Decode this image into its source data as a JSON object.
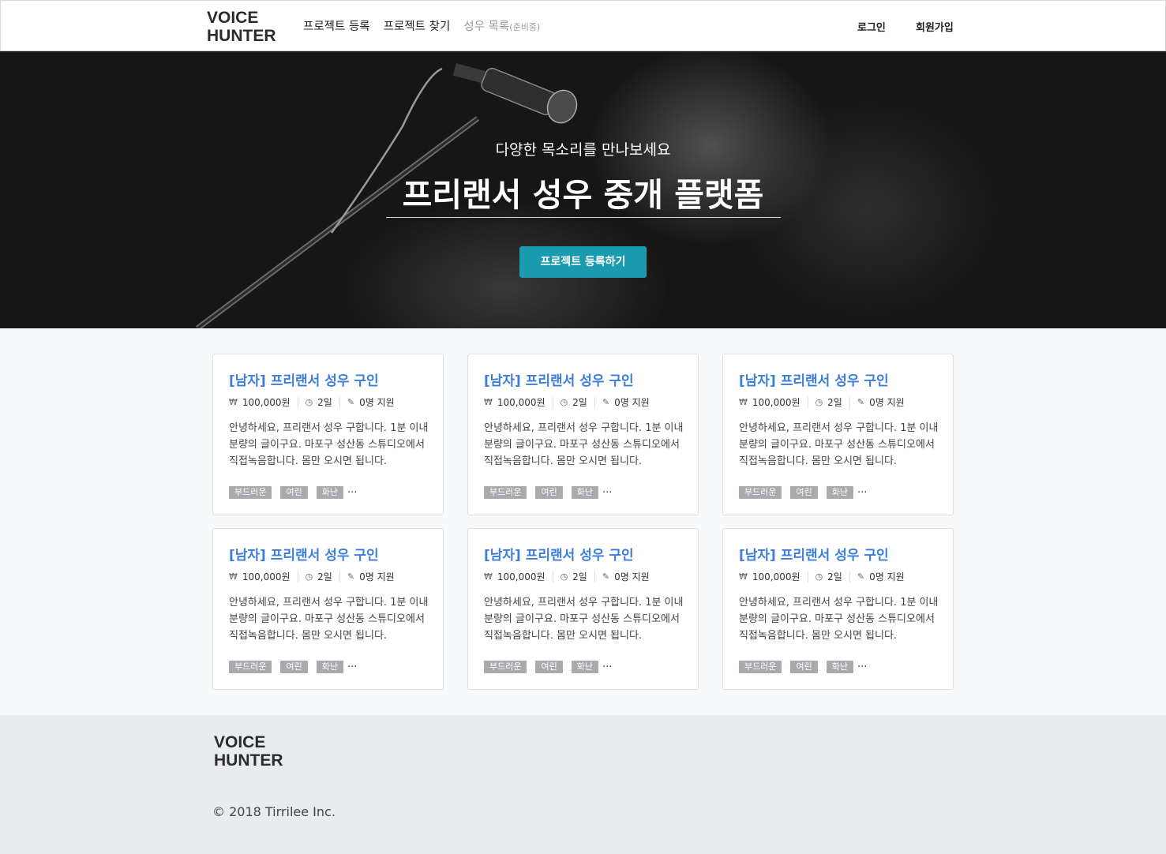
{
  "brand": {
    "line1": "VOICE",
    "line2": "HUNTER"
  },
  "nav": {
    "links": [
      "프로젝트 등록",
      "프로젝트 찾기"
    ],
    "disabled_link": "성우 목록",
    "disabled_note": "(준비중)",
    "login": "로그인",
    "signup": "회원가입"
  },
  "hero": {
    "subtitle": "다양한 목소리를 만나보세요",
    "title": "프리랜서 성우 중개 플랫폼",
    "cta": "프로젝트 등록하기"
  },
  "cards": [
    {
      "title": "[남자] 프리랜서 성우 구인",
      "price": "100,000원",
      "duration": "2일",
      "applicants": "0명 지원",
      "desc": "안녕하세요, 프리랜서 성우 구합니다. 1분 이내 분량의 글이구요. 마포구 성산동 스튜디오에서 직접녹음합니다. 몸만 오시면 됩니다.",
      "tags": [
        "부드러운",
        "여린",
        "화난"
      ],
      "more": "···"
    },
    {
      "title": "[남자] 프리랜서 성우 구인",
      "price": "100,000원",
      "duration": "2일",
      "applicants": "0명 지원",
      "desc": "안녕하세요, 프리랜서 성우 구합니다. 1분 이내 분량의 글이구요. 마포구 성산동 스튜디오에서 직접녹음합니다. 몸만 오시면 됩니다.",
      "tags": [
        "부드러운",
        "여린",
        "화난"
      ],
      "more": "···"
    },
    {
      "title": "[남자] 프리랜서 성우 구인",
      "price": "100,000원",
      "duration": "2일",
      "applicants": "0명 지원",
      "desc": "안녕하세요, 프리랜서 성우 구합니다. 1분 이내 분량의 글이구요. 마포구 성산동 스튜디오에서 직접녹음합니다. 몸만 오시면 됩니다.",
      "tags": [
        "부드러운",
        "여린",
        "화난"
      ],
      "more": "···"
    },
    {
      "title": "[남자] 프리랜서 성우 구인",
      "price": "100,000원",
      "duration": "2일",
      "applicants": "0명 지원",
      "desc": "안녕하세요, 프리랜서 성우 구합니다. 1분 이내 분량의 글이구요. 마포구 성산동 스튜디오에서 직접녹음합니다. 몸만 오시면 됩니다.",
      "tags": [
        "부드러운",
        "여린",
        "화난"
      ],
      "more": "···"
    },
    {
      "title": "[남자] 프리랜서 성우 구인",
      "price": "100,000원",
      "duration": "2일",
      "applicants": "0명 지원",
      "desc": "안녕하세요, 프리랜서 성우 구합니다. 1분 이내 분량의 글이구요. 마포구 성산동 스튜디오에서 직접녹음합니다. 몸만 오시면 됩니다.",
      "tags": [
        "부드러운",
        "여린",
        "화난"
      ],
      "more": "···"
    },
    {
      "title": "[남자] 프리랜서 성우 구인",
      "price": "100,000원",
      "duration": "2일",
      "applicants": "0명 지원",
      "desc": "안녕하세요, 프리랜서 성우 구합니다. 1분 이내 분량의 글이구요. 마포구 성산동 스튜디오에서 직접녹음합니다. 몸만 오시면 됩니다.",
      "tags": [
        "부드러운",
        "여린",
        "화난"
      ],
      "more": "···"
    }
  ],
  "icons": {
    "price": "won-icon",
    "duration": "clock-icon",
    "applicants": "pencil-icon",
    "hero_image": "microphone-stand-image"
  },
  "colors": {
    "accent": "#1b9bb0",
    "card_title": "#3b7dd8",
    "tag_bg": "#a7abaf",
    "footer_bg": "#e9ecef"
  },
  "footer": {
    "copyright": "© 2018 Tirrilee Inc."
  }
}
